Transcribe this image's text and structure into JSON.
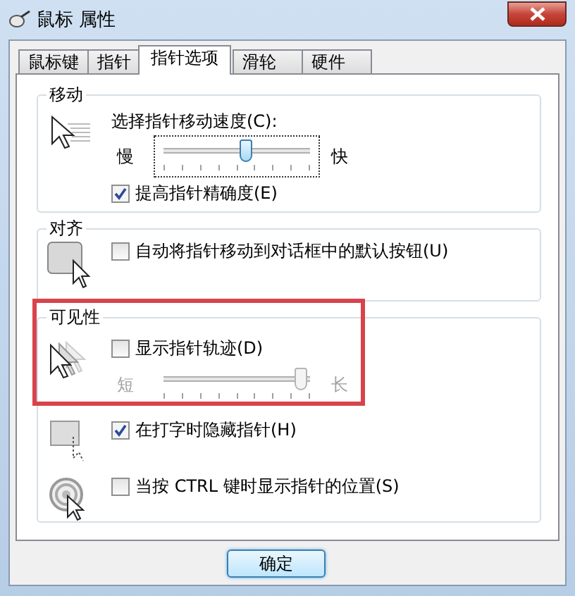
{
  "window": {
    "title": "鼠标 属性"
  },
  "tabs": [
    {
      "label": "鼠标键",
      "selected": false
    },
    {
      "label": "指针",
      "selected": false
    },
    {
      "label": "指针选项",
      "selected": true
    },
    {
      "label": "滑轮",
      "selected": false
    },
    {
      "label": "硬件",
      "selected": false
    }
  ],
  "groups": [
    {
      "title": "移动",
      "sections": [
        {
          "controls": [
            {
              "kind": "label",
              "text": "选择指针移动速度(C):"
            },
            {
              "kind": "slider",
              "min_label": "慢",
              "max_label": "快",
              "level": 0.57,
              "focused": true
            },
            {
              "kind": "checkbox",
              "label": "提高指针精确度(E)",
              "checked": true
            }
          ]
        }
      ]
    },
    {
      "title": "对齐",
      "sections": [
        {
          "controls": [
            {
              "kind": "checkbox",
              "label": "自动将指针移动到对话框中的默认按钮(U)",
              "checked": false
            }
          ]
        }
      ]
    },
    {
      "title": "可见性",
      "sections": [
        {
          "controls": [
            {
              "kind": "checkbox",
              "label": "显示指针轨迹(D)",
              "checked": false
            },
            {
              "kind": "slider",
              "min_label": "短",
              "max_label": "长",
              "level": 0.98,
              "disabled": true
            }
          ]
        },
        {
          "controls": [
            {
              "kind": "checkbox",
              "label": "在打字时隐藏指针(H)",
              "checked": true
            }
          ]
        },
        {
          "controls": [
            {
              "kind": "checkbox",
              "label": "当按 CTRL 键时显示指针的位置(S)",
              "checked": false
            }
          ]
        }
      ]
    }
  ],
  "buttons": [
    {
      "label": "确定"
    }
  ]
}
